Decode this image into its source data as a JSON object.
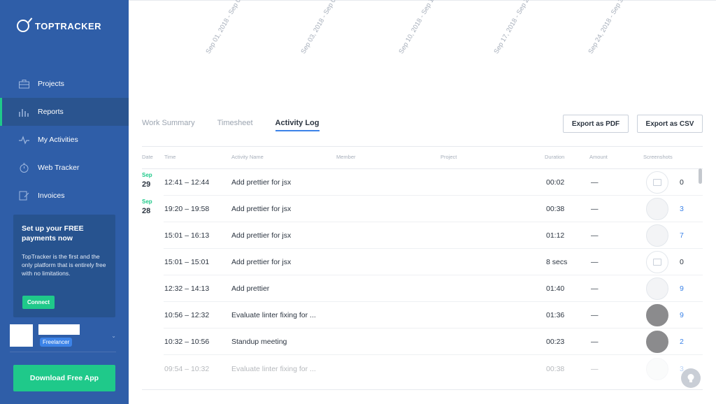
{
  "app": {
    "logo_text": "TOPTRACKER"
  },
  "sidebar": {
    "items": [
      {
        "label": "Projects",
        "icon": "briefcase-icon"
      },
      {
        "label": "Reports",
        "icon": "bar-chart-icon",
        "active": true
      },
      {
        "label": "My Activities",
        "icon": "activity-pulse-icon"
      },
      {
        "label": "Web Tracker",
        "icon": "stopwatch-icon"
      },
      {
        "label": "Invoices",
        "icon": "invoice-icon"
      }
    ],
    "promo": {
      "title": "Set up your FREE payments now",
      "body": "TopTracker is the first and the only platform that is entirely free with no limitations.",
      "button": "Connect"
    },
    "user": {
      "role": "Freelancer"
    },
    "download_label": "Download Free App"
  },
  "timeline": {
    "dates": [
      "Sep 01, 2018 - Sep 0",
      "Sep 03, 2018 - Sep 0",
      "Sep 10, 2018 - Sep 1",
      "Sep 17, 2018 - Sep 2",
      "Sep 24, 2018 - Sep 3"
    ]
  },
  "tabs": [
    "Work Summary",
    "Timesheet",
    "Activity Log"
  ],
  "active_tab": "Activity Log",
  "actions": {
    "export_pdf": "Export as PDF",
    "export_csv": "Export as CSV"
  },
  "table": {
    "columns": [
      "Date",
      "Time",
      "Activity Name",
      "Member",
      "Project",
      "Duration",
      "Amount",
      "Screenshots"
    ],
    "rows": [
      {
        "date_month": "Sep",
        "date_day": "29",
        "time": "12:41 – 12:44",
        "activity": "Add prettier for jsx",
        "duration": "00:02",
        "amount": "—",
        "screenshots": "0"
      },
      {
        "date_month": "Sep",
        "date_day": "28",
        "time": "19:20 – 19:58",
        "activity": "Add prettier for jsx",
        "duration": "00:38",
        "amount": "—",
        "screenshots": "3"
      },
      {
        "time": "15:01 – 16:13",
        "activity": "Add prettier for jsx",
        "duration": "01:12",
        "amount": "—",
        "screenshots": "7"
      },
      {
        "time": "15:01 – 15:01",
        "activity": "Add prettier for jsx",
        "duration": "8 secs",
        "amount": "—",
        "screenshots": "0"
      },
      {
        "time": "12:32 – 14:13",
        "activity": "Add prettier",
        "duration": "01:40",
        "amount": "—",
        "screenshots": "9"
      },
      {
        "time": "10:56 – 12:32",
        "activity": "Evaluate linter fixing for ...",
        "duration": "01:36",
        "amount": "—",
        "screenshots": "9"
      },
      {
        "time": "10:32 – 10:56",
        "activity": "Standup meeting",
        "duration": "00:23",
        "amount": "—",
        "screenshots": "2"
      },
      {
        "time": "09:54 – 10:32",
        "activity": "Evaluate linter fixing for ...",
        "duration": "00:38",
        "amount": "—",
        "screenshots": "3"
      }
    ]
  },
  "colors": {
    "sidebar": "#2f5ea8",
    "accent_green": "#1fc98a",
    "accent_blue": "#3c83e8"
  }
}
